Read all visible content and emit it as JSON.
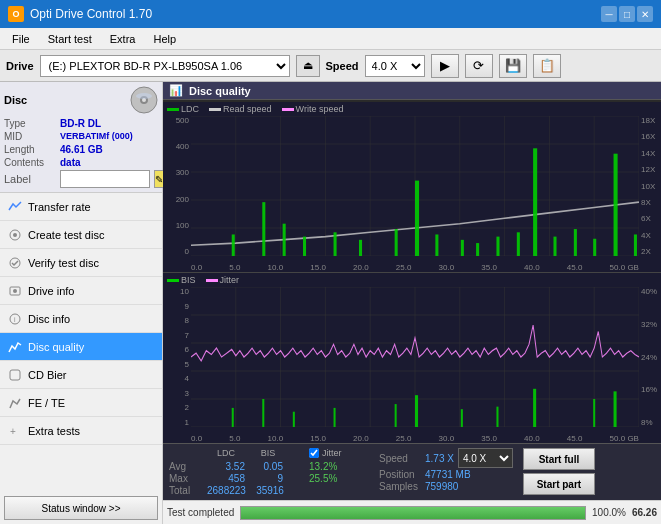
{
  "app": {
    "title": "Opti Drive Control 1.70",
    "icon": "O"
  },
  "titlebar": {
    "minimize": "─",
    "maximize": "□",
    "close": "✕"
  },
  "menu": {
    "items": [
      "File",
      "Start test",
      "Extra",
      "Help"
    ]
  },
  "drive_bar": {
    "label": "Drive",
    "drive_value": "(E:)  PLEXTOR BD-R  PX-LB950SA 1.06",
    "speed_label": "Speed",
    "speed_value": "4.0 X"
  },
  "disc": {
    "title": "Disc",
    "type_label": "Type",
    "type_value": "BD-R DL",
    "mid_label": "MID",
    "mid_value": "VERBATIMf (000)",
    "length_label": "Length",
    "length_value": "46.61 GB",
    "contents_label": "Contents",
    "contents_value": "data",
    "label_label": "Label",
    "label_value": ""
  },
  "nav_items": [
    {
      "id": "transfer-rate",
      "label": "Transfer rate",
      "active": false
    },
    {
      "id": "create-test-disc",
      "label": "Create test disc",
      "active": false
    },
    {
      "id": "verify-test-disc",
      "label": "Verify test disc",
      "active": false
    },
    {
      "id": "drive-info",
      "label": "Drive info",
      "active": false
    },
    {
      "id": "disc-info",
      "label": "Disc info",
      "active": false
    },
    {
      "id": "disc-quality",
      "label": "Disc quality",
      "active": true
    },
    {
      "id": "cd-bier",
      "label": "CD Bier",
      "active": false
    },
    {
      "id": "fe-te",
      "label": "FE / TE",
      "active": false
    },
    {
      "id": "extra-tests",
      "label": "Extra tests",
      "active": false
    }
  ],
  "status_window_btn": "Status window >>",
  "chart": {
    "title": "Disc quality",
    "top_legend": [
      "LDC",
      "Read speed",
      "Write speed"
    ],
    "top_y_labels": [
      "500",
      "400",
      "300",
      "200",
      "100",
      "0"
    ],
    "top_y_right": [
      "18X",
      "16X",
      "14X",
      "12X",
      "10X",
      "8X",
      "6X",
      "4X",
      "2X"
    ],
    "bottom_legend": [
      "BIS",
      "Jitter"
    ],
    "bottom_y_labels": [
      "10",
      "9",
      "8",
      "7",
      "6",
      "5",
      "4",
      "3",
      "2",
      "1"
    ],
    "bottom_y_right": [
      "40%",
      "32%",
      "24%",
      "16%",
      "8%"
    ],
    "x_labels": [
      "0.0",
      "5.0",
      "10.0",
      "15.0",
      "20.0",
      "25.0",
      "30.0",
      "35.0",
      "40.0",
      "45.0",
      "50.0 GB"
    ]
  },
  "stats": {
    "col_headers": [
      "",
      "LDC",
      "BIS",
      "",
      "Jitter",
      "Speed",
      "",
      ""
    ],
    "avg_label": "Avg",
    "avg_ldc": "3.52",
    "avg_bis": "0.05",
    "avg_jitter": "13.2%",
    "max_label": "Max",
    "max_ldc": "458",
    "max_bis": "9",
    "max_jitter": "25.5%",
    "total_label": "Total",
    "total_ldc": "2688223",
    "total_bis": "35916",
    "jitter_label": "Jitter",
    "speed_label": "Speed",
    "speed_value": "1.73 X",
    "speed_select": "4.0 X",
    "position_label": "Position",
    "position_value": "47731 MB",
    "samples_label": "Samples",
    "samples_value": "759980",
    "start_full": "Start full",
    "start_part": "Start part"
  },
  "progress": {
    "status_text": "Test completed",
    "percent": "100.0%",
    "value": 100,
    "right_value": "66.26"
  },
  "colors": {
    "ldc": "#00aa00",
    "read_speed": "#aaaaaa",
    "write_speed": "#ff69b4",
    "bis": "#00cc00",
    "jitter": "#ff88ff",
    "accent": "#3399ff",
    "bg_dark": "#1e2040"
  }
}
